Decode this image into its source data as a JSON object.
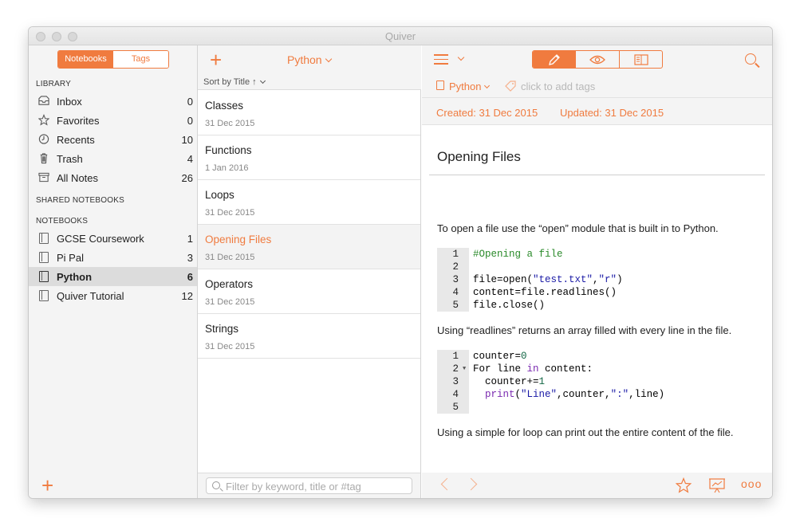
{
  "window": {
    "title": "Quiver"
  },
  "sidebar": {
    "segments": {
      "notebooks": "Notebooks",
      "tags": "Tags"
    },
    "library_header": "LIBRARY",
    "library": [
      {
        "label": "Inbox",
        "count": "0",
        "icon": "inbox-icon"
      },
      {
        "label": "Favorites",
        "count": "0",
        "icon": "star-icon"
      },
      {
        "label": "Recents",
        "count": "10",
        "icon": "clock-icon"
      },
      {
        "label": "Trash",
        "count": "4",
        "icon": "trash-icon"
      },
      {
        "label": "All Notes",
        "count": "26",
        "icon": "archive-icon"
      }
    ],
    "shared_header": "SHARED NOTEBOOKS",
    "notebooks_header": "NOTEBOOKS",
    "notebooks": [
      {
        "label": "GCSE Coursework",
        "count": "1"
      },
      {
        "label": "Pi Pal",
        "count": "3"
      },
      {
        "label": "Python",
        "count": "6",
        "selected": true
      },
      {
        "label": "Quiver Tutorial",
        "count": "12"
      }
    ]
  },
  "note_list": {
    "notebook_select": "Python",
    "sort_label": "Sort by Title ↑",
    "notes": [
      {
        "title": "Classes",
        "date": "31 Dec 2015"
      },
      {
        "title": "Functions",
        "date": "1 Jan 2016"
      },
      {
        "title": "Loops",
        "date": "31 Dec 2015"
      },
      {
        "title": "Opening Files",
        "date": "31 Dec 2015",
        "selected": true
      },
      {
        "title": "Operators",
        "date": "31 Dec 2015"
      },
      {
        "title": "Strings",
        "date": "31 Dec 2015"
      }
    ],
    "filter_placeholder": "Filter by keyword, title or #tag"
  },
  "editor": {
    "notebook": "Python",
    "tags_placeholder": "click to add tags",
    "created": "Created: 31 Dec 2015",
    "updated": "Updated: 31 Dec 2015",
    "note_title": "Opening Files",
    "para1": "To open a file use the “open” module that is built in to Python.",
    "code1": {
      "gutter": [
        "1",
        "2",
        "3",
        "4",
        "5"
      ],
      "l1": "#Opening a file",
      "l3a": "file=open(",
      "l3s1": "\"test.txt\"",
      "l3c": ",",
      "l3s2": "\"r\"",
      "l3e": ")",
      "l4": "content=file.readlines()",
      "l5": "file.close()"
    },
    "para2": "Using “readlines” returns an array filled with every line in the file.",
    "code2": {
      "gutter": [
        "1",
        "2",
        "3",
        "4",
        "5"
      ],
      "l1a": "counter=",
      "l1n": "0",
      "l2a": "For line ",
      "l2k": "in",
      "l2b": " content:",
      "l3a": "  counter+=",
      "l3n": "1",
      "l4k": "  print",
      "l4a": "(",
      "l4s1": "\"Line\"",
      "l4b": ",counter,",
      "l4s2": "\":\"",
      "l4c": ",line)"
    },
    "para3": "Using a simple for loop can print out the entire content of the file."
  },
  "colors": {
    "accent": "#f07b3f",
    "sidebar_bg": "#f4f4f4",
    "selected_row": "#dcdcdc"
  }
}
